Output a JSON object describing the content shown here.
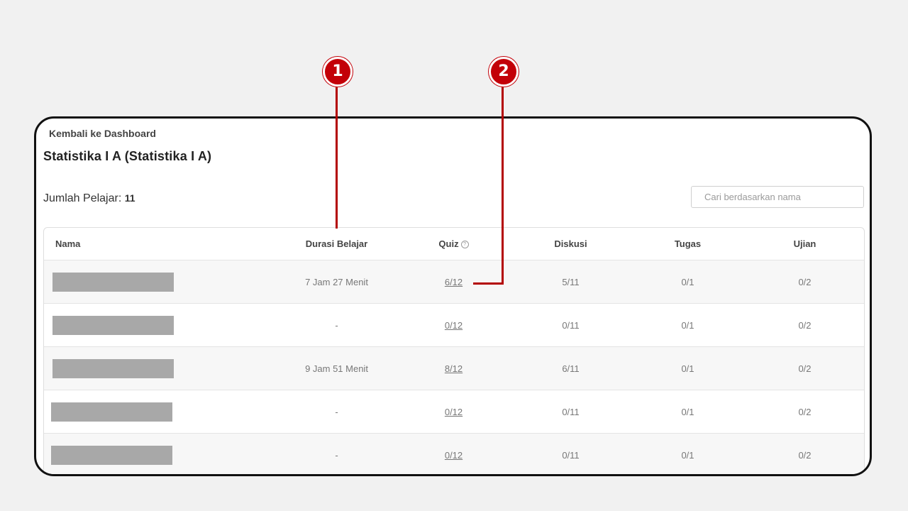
{
  "back_link": "Kembali ke Dashboard",
  "page_title": "Statistika I A (Statistika I A)",
  "student_count": {
    "label": "Jumlah Pelajar:",
    "value": "11"
  },
  "search": {
    "placeholder": "Cari berdasarkan nama",
    "value": ""
  },
  "table": {
    "headers": [
      "Nama",
      "Durasi Belajar",
      "Quiz",
      "Diskusi",
      "Tugas",
      "Ujian"
    ],
    "help_icon": "?",
    "rows": [
      {
        "durasi": "7 Jam 27 Menit",
        "quiz": "6/12",
        "diskusi": "5/11",
        "tugas": "0/1",
        "ujian": "0/2"
      },
      {
        "durasi": "-",
        "quiz": "0/12",
        "diskusi": "0/11",
        "tugas": "0/1",
        "ujian": "0/2"
      },
      {
        "durasi": "9 Jam 51 Menit",
        "quiz": "8/12",
        "diskusi": "6/11",
        "tugas": "0/1",
        "ujian": "0/2"
      },
      {
        "durasi": "-",
        "quiz": "0/12",
        "diskusi": "0/11",
        "tugas": "0/1",
        "ujian": "0/2"
      },
      {
        "durasi": "-",
        "quiz": "0/12",
        "diskusi": "0/11",
        "tugas": "0/1",
        "ujian": "0/2"
      }
    ]
  },
  "callouts": [
    "1",
    "2"
  ],
  "colors": {
    "callout": "#c30008",
    "frame": "#111111"
  }
}
